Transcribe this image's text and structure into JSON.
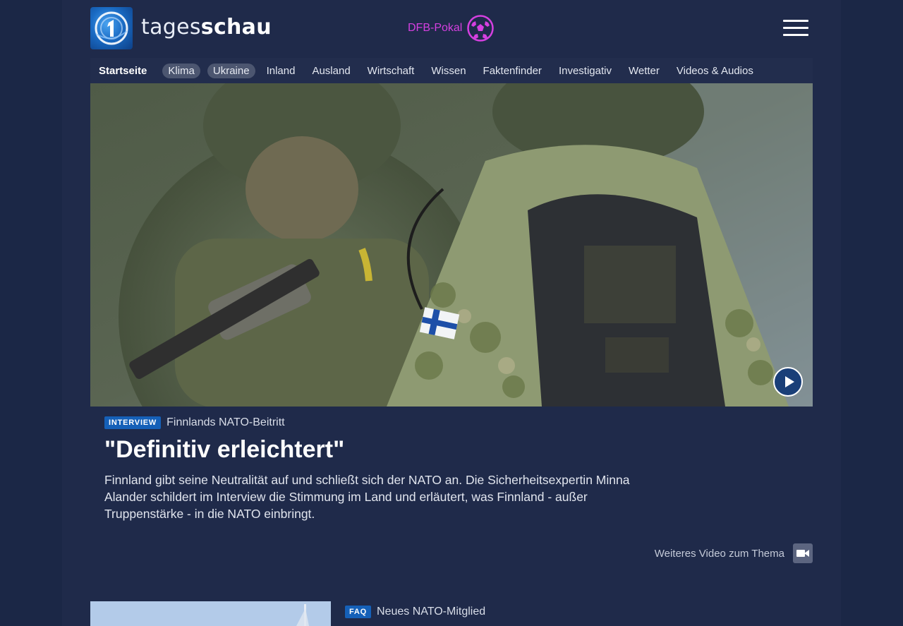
{
  "header": {
    "brand_light": "tages",
    "brand_bold": "schau",
    "topic_link": "DFB-Pokal",
    "topic_icon": "soccer-ball-icon",
    "menu_icon": "hamburger-menu-icon",
    "accent_color": "#d540e0"
  },
  "nav": {
    "items": [
      {
        "label": "Startseite",
        "style": "active"
      },
      {
        "label": "Klima",
        "style": "pill"
      },
      {
        "label": "Ukraine",
        "style": "pill"
      },
      {
        "label": "Inland"
      },
      {
        "label": "Ausland"
      },
      {
        "label": "Wirtschaft"
      },
      {
        "label": "Wissen"
      },
      {
        "label": "Faktenfinder"
      },
      {
        "label": "Investigativ"
      },
      {
        "label": "Wetter"
      },
      {
        "label": "Videos & Audios"
      }
    ]
  },
  "hero": {
    "play_icon": "play-icon",
    "badge": "INTERVIEW",
    "kicker": "Finnlands NATO-Beitritt",
    "headline": "\"Definitiv erleichtert\"",
    "teaser": "Finnland gibt seine Neutralität auf und schließt sich der NATO an. Die Sicherheitsexpertin Minna Alander schildert im Interview die Stimmung im Land und erläutert, was Finnland - außer Truppenstärke - in die NATO einbringt.",
    "more_video": "Weiteres Video zum Thema",
    "more_video_icon": "video-camera-icon"
  },
  "second_teaser": {
    "badge": "FAQ",
    "kicker": "Neues NATO-Mitglied"
  }
}
